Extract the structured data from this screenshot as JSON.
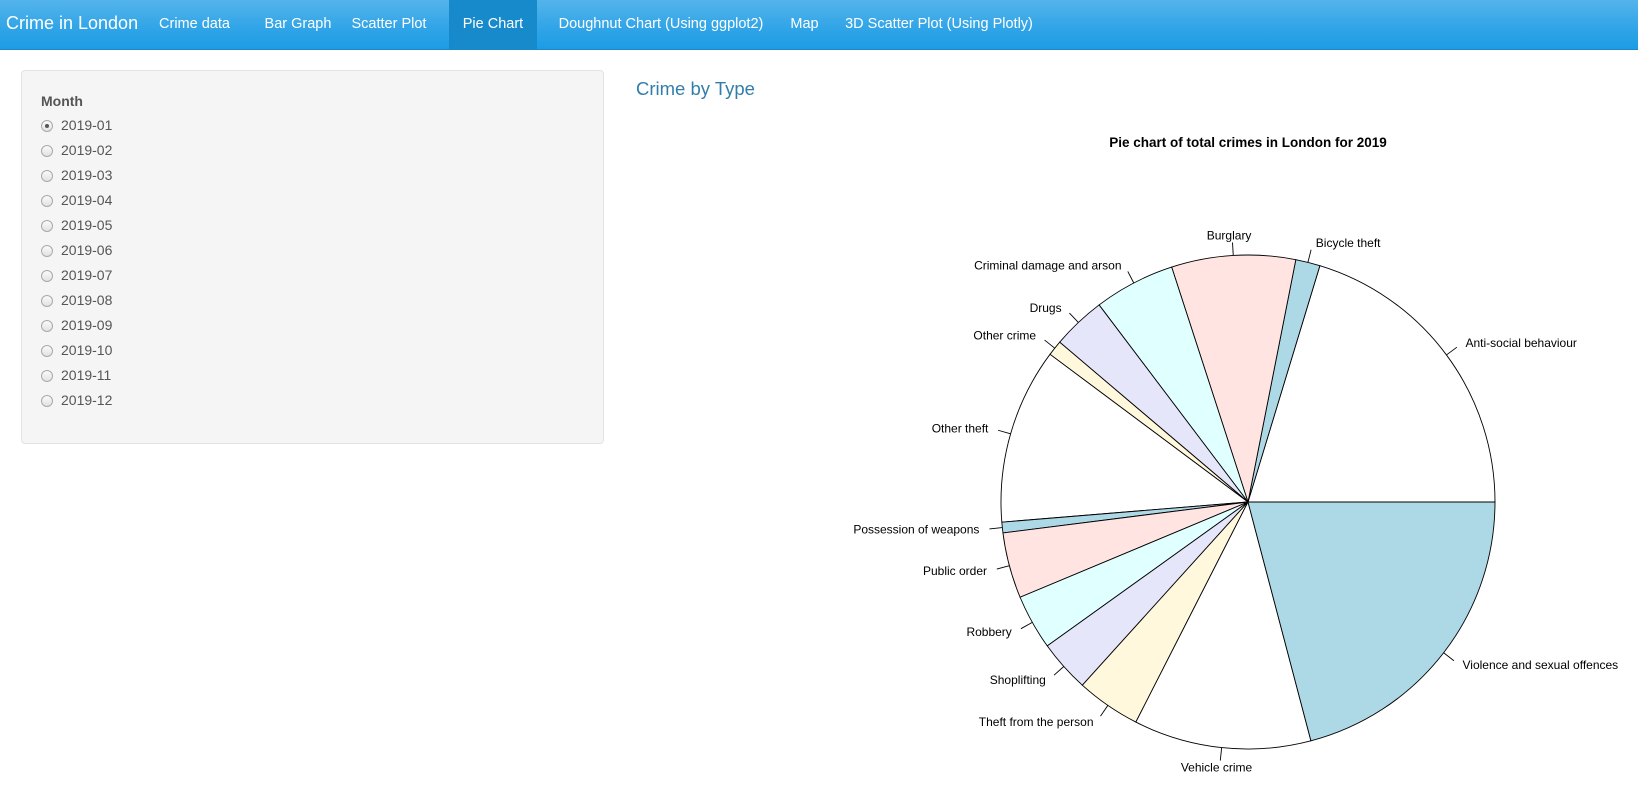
{
  "navbar": {
    "brand": "Crime in London",
    "tabs": [
      {
        "label": "Crime data",
        "active": false
      },
      {
        "label": "Bar Graph",
        "active": false
      },
      {
        "label": "Scatter Plot",
        "active": false
      },
      {
        "label": "Pie Chart",
        "active": true
      },
      {
        "label": "Doughnut Chart (Using ggplot2)",
        "active": false
      },
      {
        "label": "Map",
        "active": false
      },
      {
        "label": "3D Scatter Plot (Using Plotly)",
        "active": false
      }
    ],
    "bar_color": "#2fa4e7",
    "active_color": "#178acc"
  },
  "sidebar": {
    "label": "Month",
    "selected": "2019-01",
    "options": [
      "2019-01",
      "2019-02",
      "2019-03",
      "2019-04",
      "2019-05",
      "2019-06",
      "2019-07",
      "2019-08",
      "2019-09",
      "2019-10",
      "2019-11",
      "2019-12"
    ]
  },
  "main": {
    "title": "Crime by Type"
  },
  "chart_data": {
    "type": "pie",
    "title": "Pie chart of total crimes in London for 2019",
    "direction": "counterclockwise",
    "start": "3 o'clock",
    "categories": [
      "Anti-social behaviour",
      "Bicycle theft",
      "Burglary",
      "Criminal damage and arson",
      "Drugs",
      "Other crime",
      "Other theft",
      "Possession of weapons",
      "Public order",
      "Robbery",
      "Shoplifting",
      "Theft from the person",
      "Vehicle crime",
      "Violence and sexual offences"
    ],
    "values": [
      20.3,
      1.6,
      8.1,
      5.3,
      3.5,
      1.0,
      11.5,
      0.7,
      4.3,
      3.6,
      3.4,
      4.2,
      11.6,
      20.9
    ],
    "colors": [
      "#ffffff",
      "#add8e6",
      "#ffe4e1",
      "#e0ffff",
      "#e6e6fa",
      "#fff8dc",
      "#ffffff",
      "#add8e6",
      "#ffe4e1",
      "#e0ffff",
      "#e6e6fa",
      "#fff8dc",
      "#ffffff",
      "#add8e6"
    ]
  }
}
